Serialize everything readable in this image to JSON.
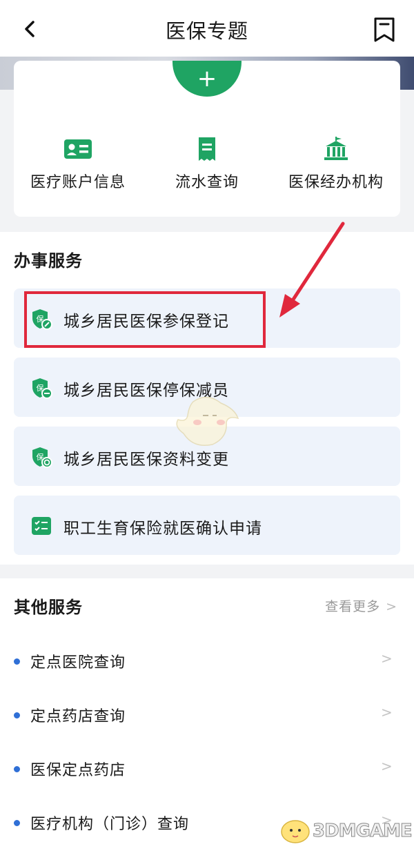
{
  "header": {
    "title": "医保专题"
  },
  "quick_actions": [
    {
      "label": "医疗账户信息",
      "icon": "id-card-icon"
    },
    {
      "label": "流水查询",
      "icon": "receipt-icon"
    },
    {
      "label": "医保经办机构",
      "icon": "building-icon"
    }
  ],
  "services": {
    "title": "办事服务",
    "items": [
      {
        "label": "城乡居民医保参保登记",
        "icon": "shield-edit-icon"
      },
      {
        "label": "城乡居民医保停保减员",
        "icon": "shield-minus-icon"
      },
      {
        "label": "城乡居民医保资料变更",
        "icon": "shield-refresh-icon"
      },
      {
        "label": "职工生育保险就医确认申请",
        "icon": "checklist-icon"
      }
    ]
  },
  "other": {
    "title": "其他服务",
    "more_label": "查看更多",
    "items": [
      {
        "label": "定点医院查询"
      },
      {
        "label": "定点药店查询"
      },
      {
        "label": "医保定点药店"
      },
      {
        "label": "医疗机构（门诊）查询"
      }
    ]
  },
  "watermark": {
    "text": "3DMGAME"
  },
  "colors": {
    "accent_green": "#1fa463",
    "highlight_red": "#e0283c",
    "bullet_blue": "#2f6fd6",
    "service_bg": "#eef3fb"
  }
}
